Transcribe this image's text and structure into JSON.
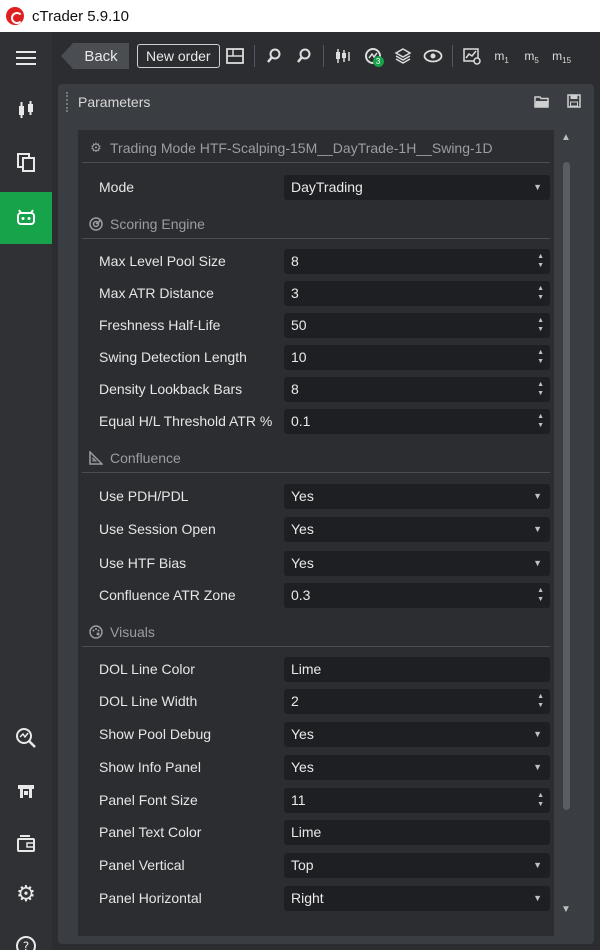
{
  "app": {
    "title": "cTrader 5.9.10"
  },
  "sidebar": {
    "items": [
      {
        "icon": "menu-icon"
      },
      {
        "icon": "chart-icon"
      },
      {
        "icon": "copy-icon"
      },
      {
        "icon": "robot-icon",
        "active": true
      },
      {
        "icon": "search-analysis-icon"
      },
      {
        "icon": "store-icon"
      },
      {
        "icon": "wallet-icon"
      },
      {
        "icon": "gear-icon"
      },
      {
        "icon": "help-icon"
      }
    ]
  },
  "toolbar": {
    "back_label": "Back",
    "new_order_label": "New order",
    "badge_count": "3",
    "timeframes": [
      {
        "label": "m",
        "sub": "1"
      },
      {
        "label": "m",
        "sub": "5"
      },
      {
        "label": "m",
        "sub": "15"
      }
    ]
  },
  "panel": {
    "title": "Parameters"
  },
  "sections": [
    {
      "title": "Trading Mode HTF-Scalping-15M__DayTrade-1H__Swing-1D",
      "icon": "gear-icon"
    },
    {
      "title": "Scoring Engine",
      "icon": "scoring-icon"
    },
    {
      "title": "Confluence",
      "icon": "triangle-ruler-icon"
    },
    {
      "title": "Visuals",
      "icon": "palette-icon"
    }
  ],
  "params": [
    {
      "label": "Mode",
      "value": "DayTrading",
      "type": "dropdown"
    },
    {
      "label": "Max Level Pool Size",
      "value": "8",
      "type": "spinner"
    },
    {
      "label": "Max ATR Distance",
      "value": "3",
      "type": "spinner"
    },
    {
      "label": "Freshness Half-Life",
      "value": "50",
      "type": "spinner"
    },
    {
      "label": "Swing Detection Length",
      "value": "10",
      "type": "spinner"
    },
    {
      "label": "Density Lookback Bars",
      "value": "8",
      "type": "spinner"
    },
    {
      "label": "Equal H/L Threshold ATR %",
      "value": "0.1",
      "type": "spinner"
    },
    {
      "label": "Use PDH/PDL",
      "value": "Yes",
      "type": "dropdown"
    },
    {
      "label": "Use Session Open",
      "value": "Yes",
      "type": "dropdown"
    },
    {
      "label": "Use HTF Bias",
      "value": "Yes",
      "type": "dropdown"
    },
    {
      "label": "Confluence ATR Zone",
      "value": "0.3",
      "type": "spinner"
    },
    {
      "label": "DOL Line Color",
      "value": "Lime",
      "type": "text"
    },
    {
      "label": "DOL Line Width",
      "value": "2",
      "type": "spinner"
    },
    {
      "label": "Show Pool Debug",
      "value": "Yes",
      "type": "dropdown"
    },
    {
      "label": "Show Info Panel",
      "value": "Yes",
      "type": "dropdown"
    },
    {
      "label": "Panel Font Size",
      "value": "11",
      "type": "spinner"
    },
    {
      "label": "Panel Text Color",
      "value": "Lime",
      "type": "text"
    },
    {
      "label": "Panel Vertical",
      "value": "Top",
      "type": "dropdown"
    },
    {
      "label": "Panel Horizontal",
      "value": "Right",
      "type": "dropdown"
    }
  ],
  "colors": {
    "accent": "#16a34a",
    "brand": "#e02020",
    "panel_bg": "#3a3d41",
    "field_bg": "#1e1f22"
  }
}
